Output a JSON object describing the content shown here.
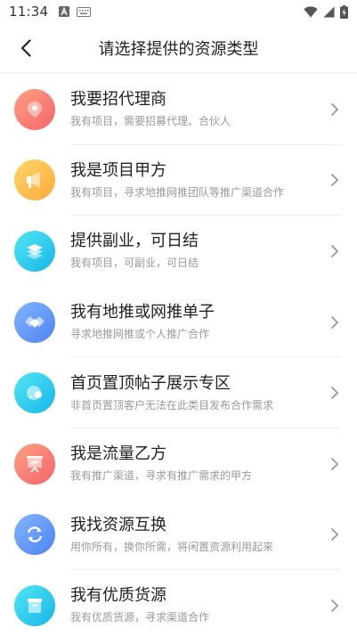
{
  "status": {
    "time": "11:34"
  },
  "header": {
    "title": "请选择提供的资源类型"
  },
  "items": [
    {
      "title": "我要招代理商",
      "subtitle": "我有项目，需要招募代理、合伙人",
      "icon": "agent-icon",
      "colors": [
        "#ff9a7c",
        "#f5676a"
      ]
    },
    {
      "title": "我是项目甲方",
      "subtitle": "我有项目，寻求地推网推团队等推广渠道合作",
      "icon": "megaphone-icon",
      "colors": [
        "#ffd26a",
        "#ffae3b"
      ]
    },
    {
      "title": "提供副业，可日结",
      "subtitle": "我有项目，可副业，可日结",
      "icon": "layers-icon",
      "colors": [
        "#4fe3f2",
        "#18b9e8"
      ]
    },
    {
      "title": "我有地推或网推单子",
      "subtitle": "寻求地推网推或个人推广合作",
      "icon": "handshake-icon",
      "colors": [
        "#7fb3ff",
        "#4f86f2"
      ]
    },
    {
      "title": "首页置顶帖子展示专区",
      "subtitle": "非首页置顶客户无法在此类目发布合作需求",
      "icon": "chat-bubble-icon",
      "colors": [
        "#4fe3f2",
        "#18b9e8"
      ]
    },
    {
      "title": "我是流量乙方",
      "subtitle": "我有推广渠道，寻求有推广需求的甲方",
      "icon": "presentation-icon",
      "colors": [
        "#ff9a7c",
        "#f5676a"
      ]
    },
    {
      "title": "我找资源互换",
      "subtitle": "用你所有，换你所需，将闲置资源利用起来",
      "icon": "exchange-icon",
      "colors": [
        "#7fb3ff",
        "#4f86f2"
      ]
    },
    {
      "title": "我有优质货源",
      "subtitle": "我有优质货源，寻求渠道合作",
      "icon": "goods-box-icon",
      "colors": [
        "#4fe3f2",
        "#18b9e8"
      ]
    }
  ]
}
